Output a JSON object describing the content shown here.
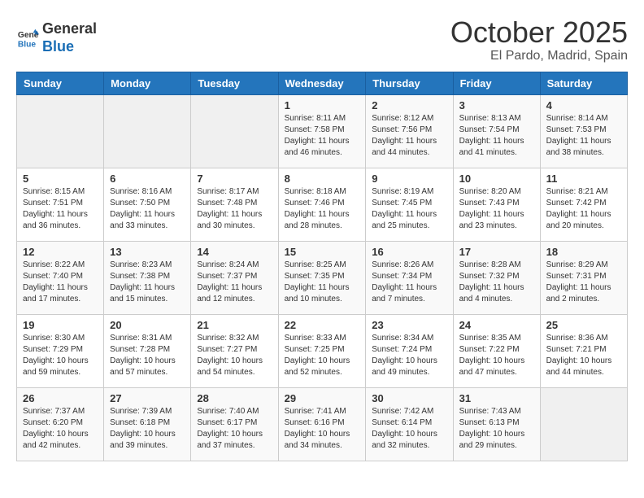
{
  "header": {
    "logo_line1": "General",
    "logo_line2": "Blue",
    "month": "October 2025",
    "location": "El Pardo, Madrid, Spain"
  },
  "weekdays": [
    "Sunday",
    "Monday",
    "Tuesday",
    "Wednesday",
    "Thursday",
    "Friday",
    "Saturday"
  ],
  "weeks": [
    [
      {
        "day": "",
        "info": ""
      },
      {
        "day": "",
        "info": ""
      },
      {
        "day": "",
        "info": ""
      },
      {
        "day": "1",
        "info": "Sunrise: 8:11 AM\nSunset: 7:58 PM\nDaylight: 11 hours\nand 46 minutes."
      },
      {
        "day": "2",
        "info": "Sunrise: 8:12 AM\nSunset: 7:56 PM\nDaylight: 11 hours\nand 44 minutes."
      },
      {
        "day": "3",
        "info": "Sunrise: 8:13 AM\nSunset: 7:54 PM\nDaylight: 11 hours\nand 41 minutes."
      },
      {
        "day": "4",
        "info": "Sunrise: 8:14 AM\nSunset: 7:53 PM\nDaylight: 11 hours\nand 38 minutes."
      }
    ],
    [
      {
        "day": "5",
        "info": "Sunrise: 8:15 AM\nSunset: 7:51 PM\nDaylight: 11 hours\nand 36 minutes."
      },
      {
        "day": "6",
        "info": "Sunrise: 8:16 AM\nSunset: 7:50 PM\nDaylight: 11 hours\nand 33 minutes."
      },
      {
        "day": "7",
        "info": "Sunrise: 8:17 AM\nSunset: 7:48 PM\nDaylight: 11 hours\nand 30 minutes."
      },
      {
        "day": "8",
        "info": "Sunrise: 8:18 AM\nSunset: 7:46 PM\nDaylight: 11 hours\nand 28 minutes."
      },
      {
        "day": "9",
        "info": "Sunrise: 8:19 AM\nSunset: 7:45 PM\nDaylight: 11 hours\nand 25 minutes."
      },
      {
        "day": "10",
        "info": "Sunrise: 8:20 AM\nSunset: 7:43 PM\nDaylight: 11 hours\nand 23 minutes."
      },
      {
        "day": "11",
        "info": "Sunrise: 8:21 AM\nSunset: 7:42 PM\nDaylight: 11 hours\nand 20 minutes."
      }
    ],
    [
      {
        "day": "12",
        "info": "Sunrise: 8:22 AM\nSunset: 7:40 PM\nDaylight: 11 hours\nand 17 minutes."
      },
      {
        "day": "13",
        "info": "Sunrise: 8:23 AM\nSunset: 7:38 PM\nDaylight: 11 hours\nand 15 minutes."
      },
      {
        "day": "14",
        "info": "Sunrise: 8:24 AM\nSunset: 7:37 PM\nDaylight: 11 hours\nand 12 minutes."
      },
      {
        "day": "15",
        "info": "Sunrise: 8:25 AM\nSunset: 7:35 PM\nDaylight: 11 hours\nand 10 minutes."
      },
      {
        "day": "16",
        "info": "Sunrise: 8:26 AM\nSunset: 7:34 PM\nDaylight: 11 hours\nand 7 minutes."
      },
      {
        "day": "17",
        "info": "Sunrise: 8:28 AM\nSunset: 7:32 PM\nDaylight: 11 hours\nand 4 minutes."
      },
      {
        "day": "18",
        "info": "Sunrise: 8:29 AM\nSunset: 7:31 PM\nDaylight: 11 hours\nand 2 minutes."
      }
    ],
    [
      {
        "day": "19",
        "info": "Sunrise: 8:30 AM\nSunset: 7:29 PM\nDaylight: 10 hours\nand 59 minutes."
      },
      {
        "day": "20",
        "info": "Sunrise: 8:31 AM\nSunset: 7:28 PM\nDaylight: 10 hours\nand 57 minutes."
      },
      {
        "day": "21",
        "info": "Sunrise: 8:32 AM\nSunset: 7:27 PM\nDaylight: 10 hours\nand 54 minutes."
      },
      {
        "day": "22",
        "info": "Sunrise: 8:33 AM\nSunset: 7:25 PM\nDaylight: 10 hours\nand 52 minutes."
      },
      {
        "day": "23",
        "info": "Sunrise: 8:34 AM\nSunset: 7:24 PM\nDaylight: 10 hours\nand 49 minutes."
      },
      {
        "day": "24",
        "info": "Sunrise: 8:35 AM\nSunset: 7:22 PM\nDaylight: 10 hours\nand 47 minutes."
      },
      {
        "day": "25",
        "info": "Sunrise: 8:36 AM\nSunset: 7:21 PM\nDaylight: 10 hours\nand 44 minutes."
      }
    ],
    [
      {
        "day": "26",
        "info": "Sunrise: 7:37 AM\nSunset: 6:20 PM\nDaylight: 10 hours\nand 42 minutes."
      },
      {
        "day": "27",
        "info": "Sunrise: 7:39 AM\nSunset: 6:18 PM\nDaylight: 10 hours\nand 39 minutes."
      },
      {
        "day": "28",
        "info": "Sunrise: 7:40 AM\nSunset: 6:17 PM\nDaylight: 10 hours\nand 37 minutes."
      },
      {
        "day": "29",
        "info": "Sunrise: 7:41 AM\nSunset: 6:16 PM\nDaylight: 10 hours\nand 34 minutes."
      },
      {
        "day": "30",
        "info": "Sunrise: 7:42 AM\nSunset: 6:14 PM\nDaylight: 10 hours\nand 32 minutes."
      },
      {
        "day": "31",
        "info": "Sunrise: 7:43 AM\nSunset: 6:13 PM\nDaylight: 10 hours\nand 29 minutes."
      },
      {
        "day": "",
        "info": ""
      }
    ]
  ]
}
